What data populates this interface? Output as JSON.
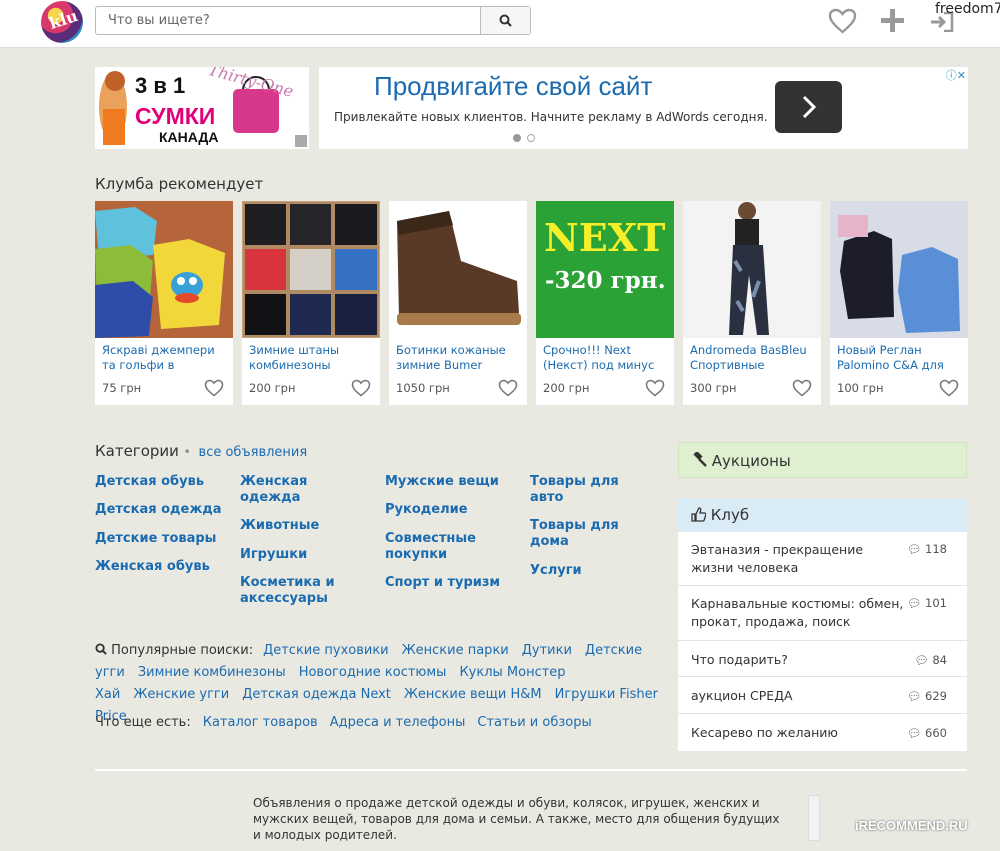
{
  "header": {
    "search_placeholder": "Что вы ищете?",
    "username": "freedom7"
  },
  "ads": {
    "left_banner": {
      "line1": "3 в 1",
      "line2": "СУМКИ",
      "line3": "КАНАДА",
      "script": "Thirty-One"
    },
    "right_banner": {
      "title": "Продвигайте свой сайт",
      "subtitle": "Привлекайте новых клиентов. Начните рекламу в AdWords сегодня."
    }
  },
  "recommend": {
    "title": "Клумба рекомендует",
    "items": [
      {
        "title": "Яскраві джемпери та гольфи в",
        "price": "75 грн"
      },
      {
        "title": "Зимние штаны комбинезоны",
        "price": "200 грн"
      },
      {
        "title": "Ботинки кожаные зимние Bumer",
        "price": "1050 грн"
      },
      {
        "title": "Срочно!!! Next (Некст) под минус",
        "price": "200 грн",
        "img_text1": "NEXT",
        "img_text2": "-320 грн."
      },
      {
        "title": "Andromeda BasBleu Спортивные",
        "price": "300 грн"
      },
      {
        "title": "Новый Реглан Palomino C&A для",
        "price": "100 грн"
      }
    ]
  },
  "categories": {
    "title": "Категории",
    "all_link": "все объявления",
    "col1": [
      "Детская обувь",
      "Детская одежда",
      "Детские товары",
      "Женская обувь"
    ],
    "col2": [
      "Женская одежда",
      "Животные",
      "Игрушки",
      "Косметика и аксессуары"
    ],
    "col3": [
      "Мужские вещи",
      "Рукоделие",
      "Совместные покупки",
      "Спорт и туризм"
    ],
    "col4": [
      "Товары для авто",
      "Товары для дома",
      "Услуги"
    ]
  },
  "popular": {
    "label": "Популярные поиски:",
    "links": [
      "Детские пуховики",
      "Женские парки",
      "Дутики",
      "Детские угги",
      "Зимние комбинезоны",
      "Новогодние костюмы",
      "Куклы Монстер Хай",
      "Женские угги",
      "Детская одежда Next",
      "Женские вещи H&M",
      "Игрушки Fisher Price"
    ]
  },
  "more": {
    "label": "Что еще есть:",
    "links": [
      "Каталог товаров",
      "Адреса и телефоны",
      "Статьи и обзоры"
    ]
  },
  "auctions": {
    "label": "Аукционы"
  },
  "club": {
    "title": "Клуб",
    "topics": [
      {
        "title": "Эвтаназия - прекращение жизни человека",
        "count": "118"
      },
      {
        "title": "Карнавальные костюмы: обмен, прокат, продажа, поиск",
        "count": "101"
      },
      {
        "title": "Что подарить?",
        "count": "84"
      },
      {
        "title": "аукцион СРЕДА",
        "count": "629"
      },
      {
        "title": "Кесарево по желанию",
        "count": "660"
      }
    ]
  },
  "footer": {
    "text": "Объявления о продаже детской одежды и обуви, колясок, игрушек, женских и мужских вещей, товаров для дома и семьи. А также, место для общения будущих и молодых родителей."
  },
  "watermark": "iRECOMMEND.RU"
}
